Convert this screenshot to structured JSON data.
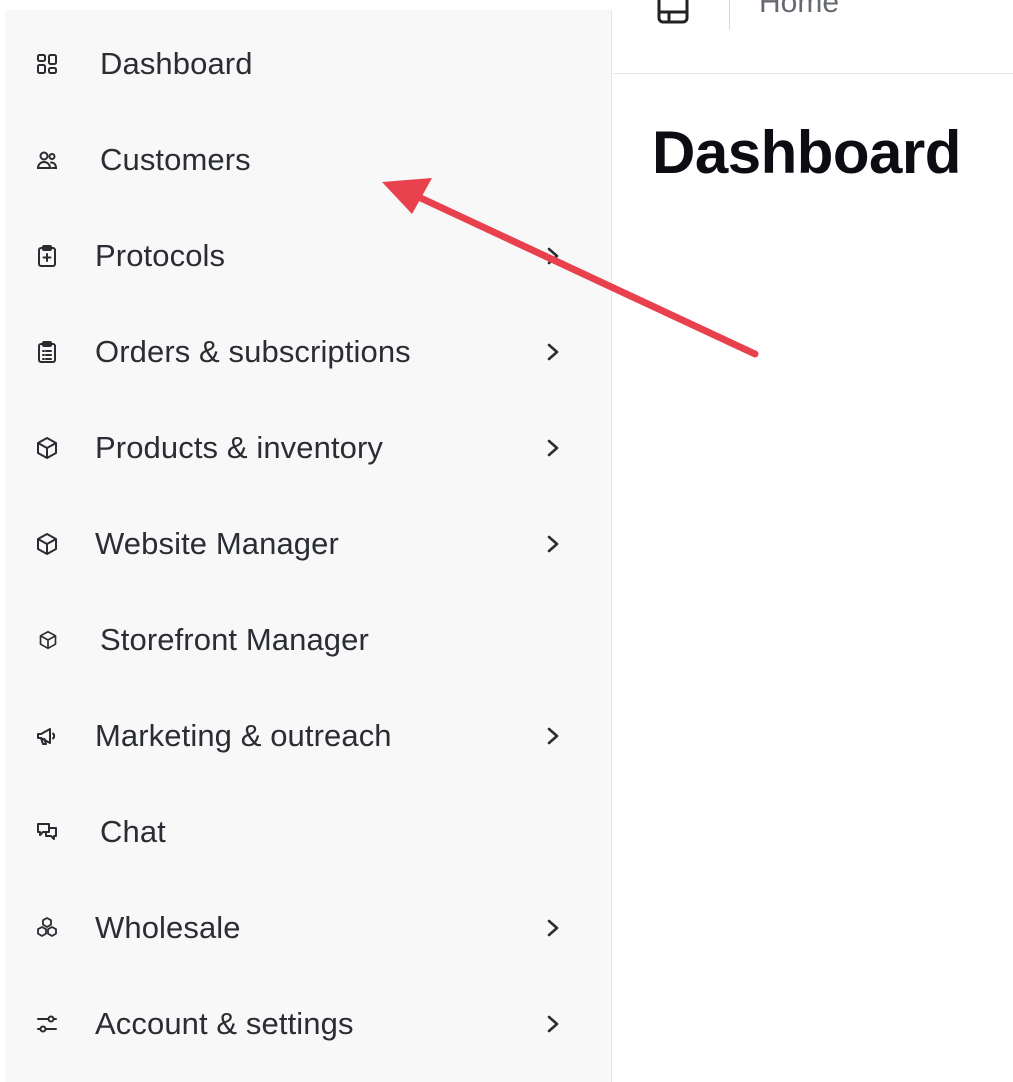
{
  "sidebar": {
    "items": [
      {
        "label": "Dashboard",
        "icon": "dashboard-grid-icon",
        "has_chevron": false
      },
      {
        "label": "Customers",
        "icon": "users-icon",
        "has_chevron": false
      },
      {
        "label": "Protocols",
        "icon": "clipboard-plus-icon",
        "has_chevron": true
      },
      {
        "label": "Orders & subscriptions",
        "icon": "clipboard-list-icon",
        "has_chevron": true
      },
      {
        "label": "Products & inventory",
        "icon": "box-icon",
        "has_chevron": true
      },
      {
        "label": "Website Manager",
        "icon": "box-icon",
        "has_chevron": true
      },
      {
        "label": "Storefront Manager",
        "icon": "box-icon",
        "has_chevron": false
      },
      {
        "label": "Marketing & outreach",
        "icon": "megaphone-icon",
        "has_chevron": true
      },
      {
        "label": "Chat",
        "icon": "chat-bubbles-icon",
        "has_chevron": false
      },
      {
        "label": "Wholesale",
        "icon": "boxes-stack-icon",
        "has_chevron": true
      },
      {
        "label": "Account & settings",
        "icon": "sliders-icon",
        "has_chevron": true
      }
    ]
  },
  "header": {
    "breadcrumb": "Home"
  },
  "main": {
    "title": "Dashboard"
  },
  "annotation": {
    "arrow_color": "#e8414d",
    "points_to": "Customers"
  }
}
